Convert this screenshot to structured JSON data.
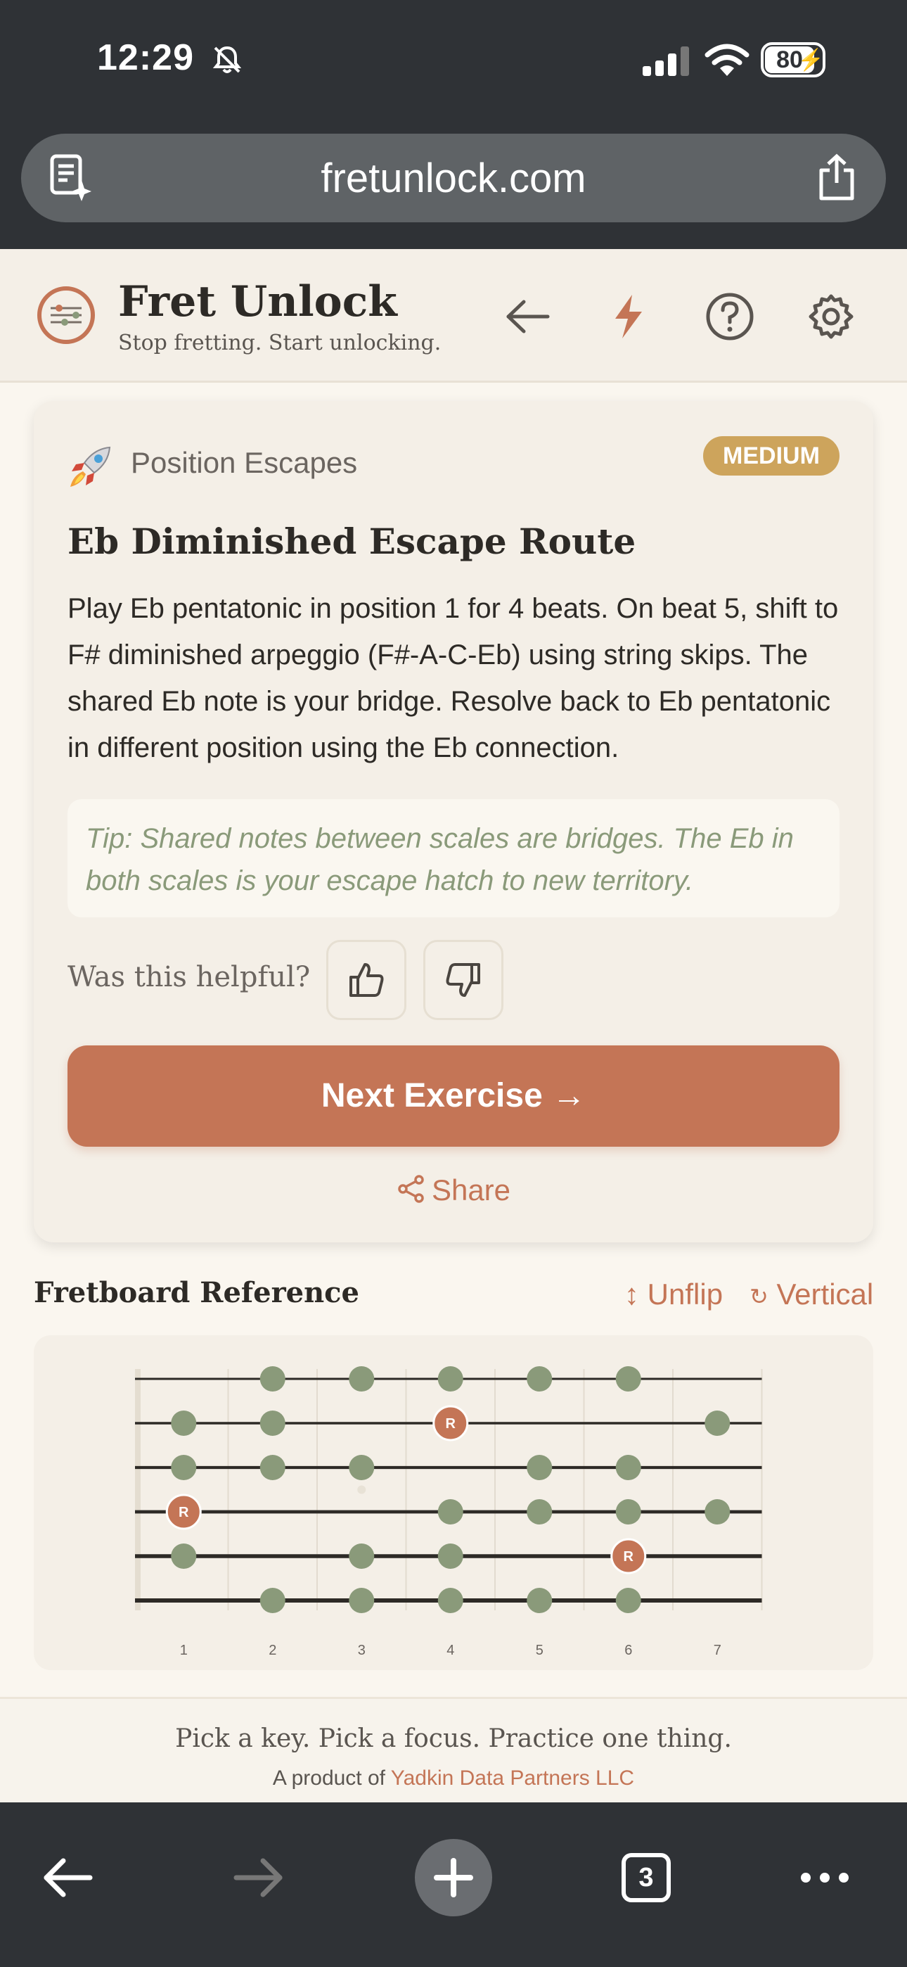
{
  "status": {
    "time": "12:29",
    "battery": "80"
  },
  "browser": {
    "url": "fretunlock.com",
    "tab_count": "3"
  },
  "app": {
    "title": "Fret Unlock",
    "tagline": "Stop fretting. Start unlocking."
  },
  "exercise": {
    "category": "Position Escapes",
    "difficulty": "MEDIUM",
    "title": "Eb Diminished Escape Route",
    "description": "Play Eb pentatonic in position 1 for 4 beats. On beat 5, shift to F# diminished arpeggio (F#-A-C-Eb) using string skips. The shared Eb note is your bridge. Resolve back to Eb pentatonic in different position using the Eb connection.",
    "tip": "Tip: Shared notes between scales are bridges. The Eb in both scales is your escape hatch to new territory.",
    "helpful_prompt": "Was this helpful?",
    "next_label": "Next Exercise →",
    "share_label": "Share"
  },
  "fretboard": {
    "title": "Fretboard Reference",
    "unflip_label": "Unflip",
    "vertical_label": "Vertical",
    "fret_numbers": [
      "1",
      "2",
      "3",
      "4",
      "5",
      "6",
      "7"
    ],
    "root_label": "R",
    "notes": [
      {
        "string": 1,
        "fret": 2,
        "root": false
      },
      {
        "string": 1,
        "fret": 3,
        "root": false
      },
      {
        "string": 1,
        "fret": 4,
        "root": false
      },
      {
        "string": 1,
        "fret": 5,
        "root": false
      },
      {
        "string": 1,
        "fret": 6,
        "root": false
      },
      {
        "string": 2,
        "fret": 1,
        "root": false
      },
      {
        "string": 2,
        "fret": 2,
        "root": false
      },
      {
        "string": 2,
        "fret": 4,
        "root": true
      },
      {
        "string": 2,
        "fret": 7,
        "root": false
      },
      {
        "string": 3,
        "fret": 1,
        "root": false
      },
      {
        "string": 3,
        "fret": 2,
        "root": false
      },
      {
        "string": 3,
        "fret": 3,
        "root": false
      },
      {
        "string": 3,
        "fret": 5,
        "root": false
      },
      {
        "string": 3,
        "fret": 6,
        "root": false
      },
      {
        "string": 4,
        "fret": 1,
        "root": true
      },
      {
        "string": 4,
        "fret": 4,
        "root": false
      },
      {
        "string": 4,
        "fret": 5,
        "root": false
      },
      {
        "string": 4,
        "fret": 6,
        "root": false
      },
      {
        "string": 4,
        "fret": 7,
        "root": false
      },
      {
        "string": 5,
        "fret": 1,
        "root": false
      },
      {
        "string": 5,
        "fret": 3,
        "root": false
      },
      {
        "string": 5,
        "fret": 4,
        "root": false
      },
      {
        "string": 5,
        "fret": 6,
        "root": true
      },
      {
        "string": 6,
        "fret": 2,
        "root": false
      },
      {
        "string": 6,
        "fret": 3,
        "root": false
      },
      {
        "string": 6,
        "fret": 4,
        "root": false
      },
      {
        "string": 6,
        "fret": 5,
        "root": false
      },
      {
        "string": 6,
        "fret": 6,
        "root": false
      }
    ]
  },
  "footer": {
    "line1": "Pick a key. Pick a focus. Practice one thing.",
    "prefix": "A product of",
    "company": "Yadkin Data Partners LLC"
  },
  "colors": {
    "accent": "#c47556",
    "note": "#8a9a7a",
    "badge": "#cda45c"
  }
}
